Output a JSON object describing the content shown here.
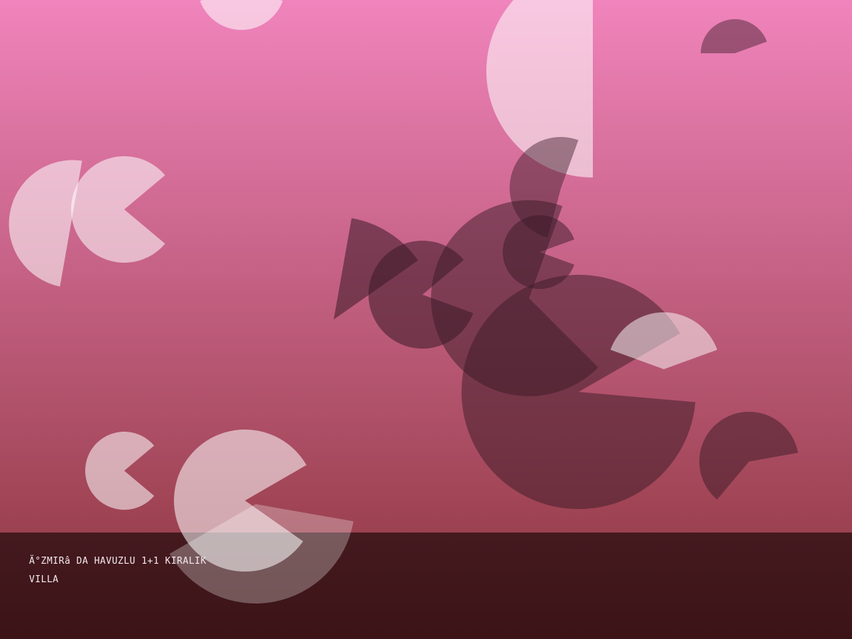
{
  "caption": {
    "text": "Ä°ZMIRâ  DA HAVUZLU 1+1 KIRALIK\nVILLA"
  },
  "colors": {
    "gradient_top": "#f084bc",
    "gradient_bottom": "#9c4150",
    "bar_top": "#441a1f",
    "bar_bottom": "#3c1316",
    "light_shape": "#ffffff",
    "dark_shape": "#3a1a26",
    "caption_text": "#f4eaf0"
  }
}
